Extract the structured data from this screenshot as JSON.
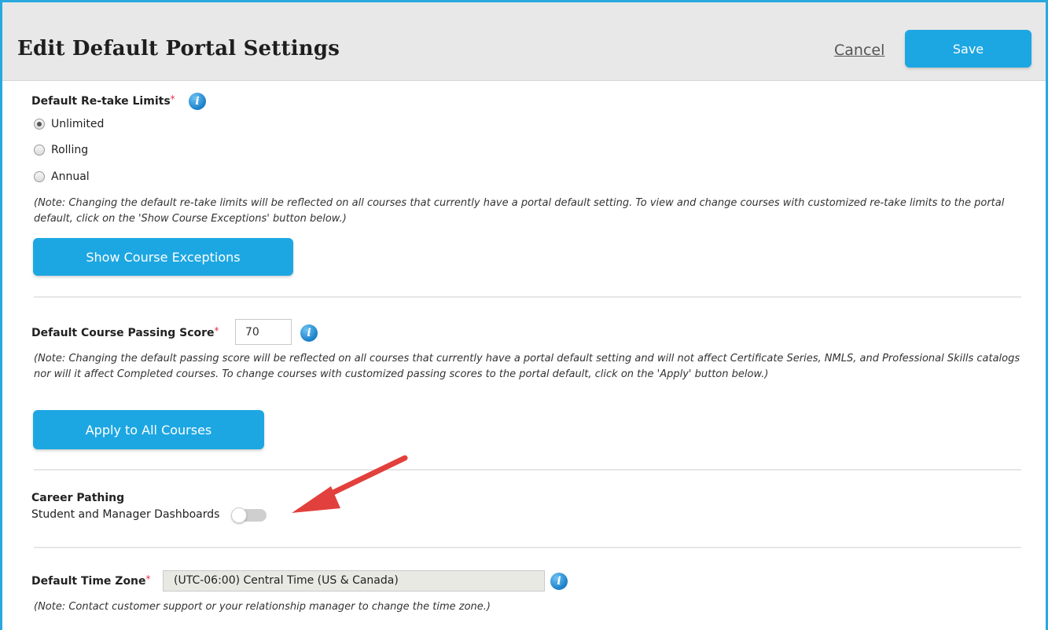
{
  "header": {
    "title": "Edit Default Portal Settings",
    "cancel_label": "Cancel",
    "save_label": "Save"
  },
  "retake": {
    "label": "Default Re-take Limits",
    "required_mark": "*",
    "options": [
      {
        "label": "Unlimited",
        "selected": true
      },
      {
        "label": "Rolling",
        "selected": false
      },
      {
        "label": "Annual",
        "selected": false
      }
    ],
    "note": "(Note: Changing the default re-take limits will be reflected on all courses that currently have a portal default setting. To view and change courses with customized re-take limits to the portal default, click on the 'Show Course Exceptions' button below.)",
    "button_label": "Show Course Exceptions"
  },
  "passing_score": {
    "label": "Default Course Passing Score",
    "required_mark": "*",
    "value": "70",
    "note": "(Note: Changing the default passing score will be reflected on all courses that currently have a portal default setting and will not affect Certificate Series, NMLS, and Professional Skills catalogs nor will it affect Completed courses. To change courses with customized passing scores to the portal default, click on the 'Apply' button below.)",
    "button_label": "Apply to All Courses"
  },
  "career_pathing": {
    "heading": "Career Pathing",
    "toggle_label": "Student and Manager Dashboards",
    "toggle_on": false
  },
  "time_zone": {
    "label": "Default Time Zone",
    "required_mark": "*",
    "value": "(UTC-06:00) Central Time (US & Canada)",
    "note": "(Note: Contact customer support or your relationship manager to change the time zone.)"
  },
  "info_glyph": "i",
  "icons": [
    "info-icon",
    "red-arrow-annotation"
  ],
  "colors": {
    "accent": "#1da7e2",
    "frame_border": "#29a8df",
    "required": "#e2313f",
    "annotation_arrow": "#e2403c"
  }
}
